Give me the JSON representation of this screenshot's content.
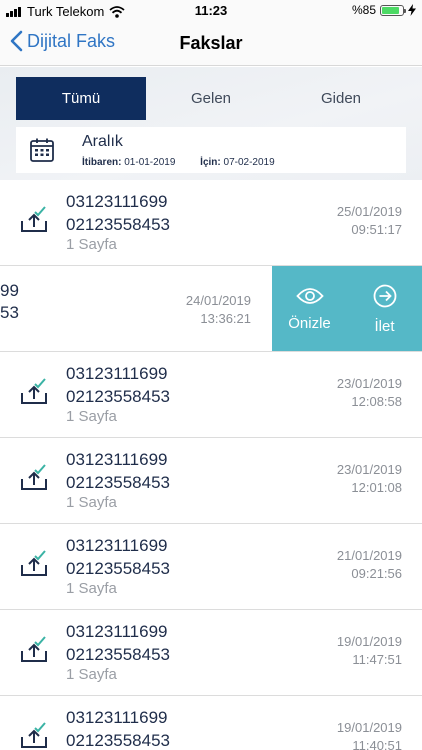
{
  "status_bar": {
    "carrier": "Turk Telekom",
    "time": "11:23",
    "battery": "%85",
    "battery_level": 0.85
  },
  "nav": {
    "back_label": "Dijital Faks",
    "title": "Fakslar"
  },
  "segments": [
    {
      "label": "Tümü",
      "active": true
    },
    {
      "label": "Gelen",
      "active": false
    },
    {
      "label": "Giden",
      "active": false
    }
  ],
  "date_filter": {
    "period": "Aralık",
    "from_label": "İtibaren:",
    "from_value": "01-01-2019",
    "to_label": "İçin:",
    "to_value": "07-02-2019"
  },
  "faxes": [
    {
      "from": "03123111699",
      "to": "02123558453",
      "pages": "1 Sayfa",
      "date": "25/01/2019",
      "time": "09:51:17"
    },
    {
      "from": "99",
      "to": "53",
      "date": "24/01/2019",
      "time": "13:36:21",
      "actions": {
        "preview": "Önizle",
        "forward": "İlet"
      }
    },
    {
      "from": "03123111699",
      "to": "02123558453",
      "pages": "1 Sayfa",
      "date": "23/01/2019",
      "time": "12:08:58"
    },
    {
      "from": "03123111699",
      "to": "02123558453",
      "pages": "1 Sayfa",
      "date": "23/01/2019",
      "time": "12:01:08"
    },
    {
      "from": "03123111699",
      "to": "02123558453",
      "pages": "1 Sayfa",
      "date": "21/01/2019",
      "time": "09:21:56"
    },
    {
      "from": "03123111699",
      "to": "02123558453",
      "pages": "1 Sayfa",
      "date": "19/01/2019",
      "time": "11:47:51"
    },
    {
      "from": "03123111699",
      "to": "02123558453",
      "date": "19/01/2019",
      "time": "11:40:51"
    }
  ],
  "colors": {
    "accent": "#0f2d5e",
    "swipe_action": "#55b8c7",
    "link": "#2f75c4"
  },
  "icons": {
    "back": "chevron-left-icon",
    "calendar": "calendar-icon",
    "fax": "upload-tray-check-icon",
    "preview": "eye-icon",
    "forward": "arrow-right-circle-icon"
  }
}
